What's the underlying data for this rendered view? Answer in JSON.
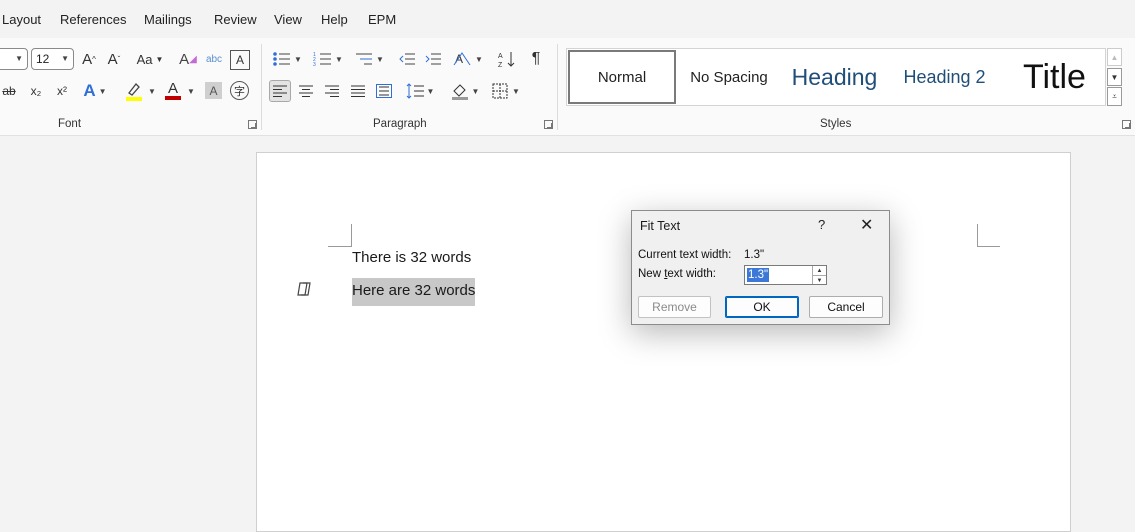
{
  "menu": {
    "tabs": [
      "Layout",
      "References",
      "Mailings",
      "Review",
      "View",
      "Help",
      "EPM"
    ]
  },
  "ribbon": {
    "font": {
      "group_label": "Font",
      "font_size": "12",
      "grow_icon": "A^",
      "shrink_icon": "Aˇ",
      "case_icon": "Aa",
      "strike_icon": "ab",
      "subscript_icon": "x₂",
      "superscript_icon": "x²",
      "font_color_letter": "A",
      "text_effects_letter": "A",
      "shading_letter": "A",
      "clear_format": "A",
      "abc": "abc",
      "font_color": "#c00000",
      "highlight_color": "#ffff00"
    },
    "paragraph": {
      "group_label": "Paragraph",
      "pilcrow": "¶"
    },
    "styles": {
      "group_label": "Styles",
      "items": [
        "Normal",
        "No Spacing",
        "Heading",
        "Heading 2",
        "Title"
      ],
      "heading_color": "#1f4e79"
    }
  },
  "document": {
    "line1": "There is 32 words",
    "line2": "Here are 32 words"
  },
  "dialog": {
    "title": "Fit Text",
    "help": "?",
    "close": "✕",
    "current_label": "Current text width:",
    "current_value": "1.3\"",
    "new_label_pre": "New ",
    "new_label_u": "t",
    "new_label_post": "ext width:",
    "new_value": "1.3\"",
    "remove_label": "Remove",
    "ok_label": "OK",
    "cancel_label": "Cancel",
    "selection_color": "#3b78d8"
  }
}
